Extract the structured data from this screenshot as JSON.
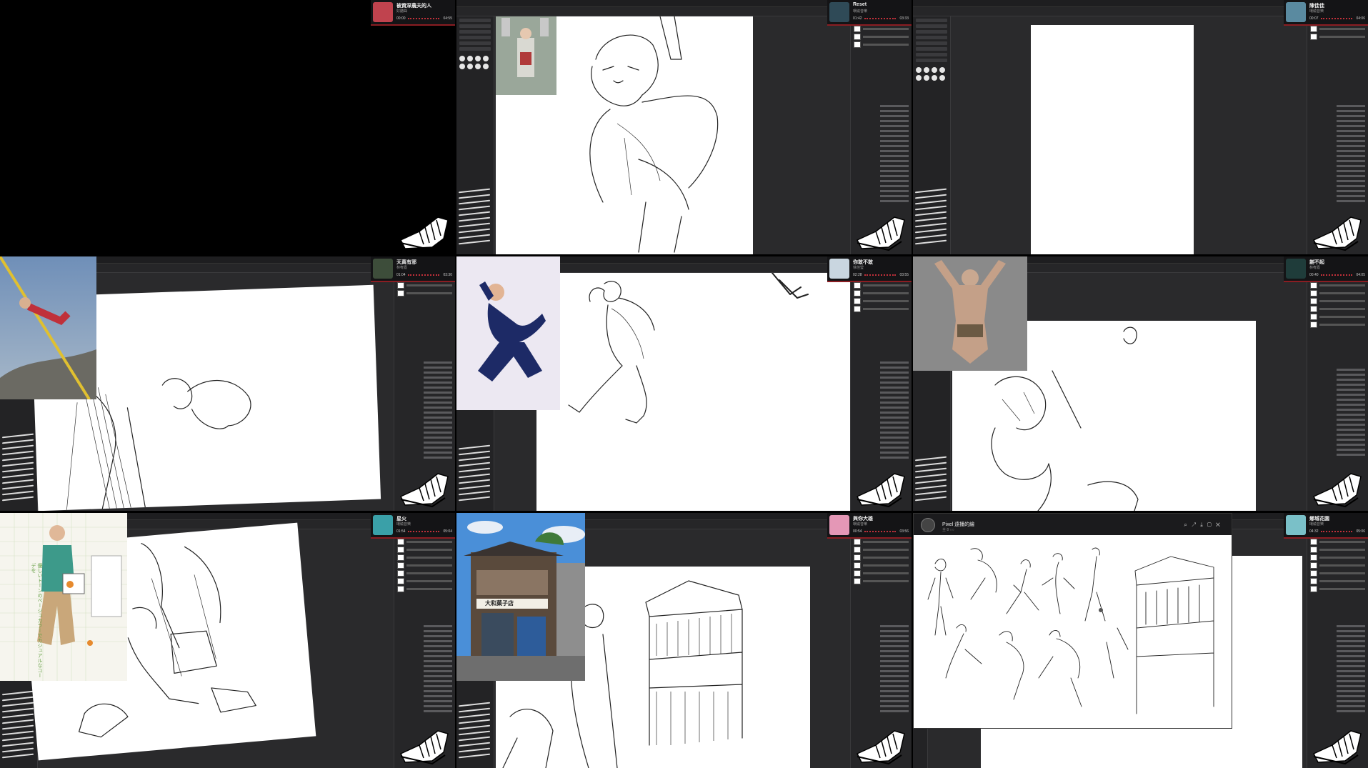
{
  "tiles": [
    {
      "music": {
        "title": "被資深農夫的人",
        "artist": "好聽曲",
        "elapsed": "00:00",
        "total": "04:55",
        "cover_color": "#c0434e"
      }
    },
    {
      "music": {
        "title": "Reset",
        "artist": "環繞音樂",
        "elapsed": "01:42",
        "total": "03:33",
        "cover_color": "#2f4a57"
      }
    },
    {
      "music": {
        "title": "陳佳佳",
        "artist": "環繞音樂",
        "elapsed": "00:07",
        "total": "04:06",
        "cover_color": "#5a8aa0"
      }
    },
    {
      "music": {
        "title": "天真有邪",
        "artist": "林宥嘉",
        "elapsed": "01:04",
        "total": "03:30",
        "cover_color": "#3d4d3a"
      }
    },
    {
      "music": {
        "title": "你敢不敢",
        "artist": "徐佳瑩",
        "elapsed": "02:28",
        "total": "03:55",
        "cover_color": "#c9d6e0"
      }
    },
    {
      "music": {
        "title": "謝不起",
        "artist": "林宥嘉",
        "elapsed": "00:40",
        "total": "04:05",
        "cover_color": "#1f3c3a"
      }
    },
    {
      "music": {
        "title": "星火",
        "artist": "環繞音樂",
        "elapsed": "01:54",
        "total": "05:04",
        "cover_color": "#3aa0a8"
      }
    },
    {
      "music": {
        "title": "與你大雄",
        "artist": "環繞音樂",
        "elapsed": "00:54",
        "total": "03:56",
        "cover_color": "#e497b6"
      }
    },
    {
      "music": {
        "title": "鄉城花園",
        "artist": "環繞音樂",
        "elapsed": "04:32",
        "total": "05:06",
        "cover_color": "#7ac0c8"
      }
    }
  ],
  "gallery": {
    "name": "Pixel 遠播的繪",
    "sub": "全 8 ○○"
  },
  "magazine_text": "優しいトーンのベージュカラーでカジュアルなコーデを",
  "shop_sign": "大和菓子店",
  "icons": {
    "logo": "shoe-sketch-logo",
    "cursor": "pen-cursor-icon"
  },
  "colors": {
    "accent": "#c0303a",
    "panel": "#262628",
    "selected_layer": "#37506e"
  }
}
